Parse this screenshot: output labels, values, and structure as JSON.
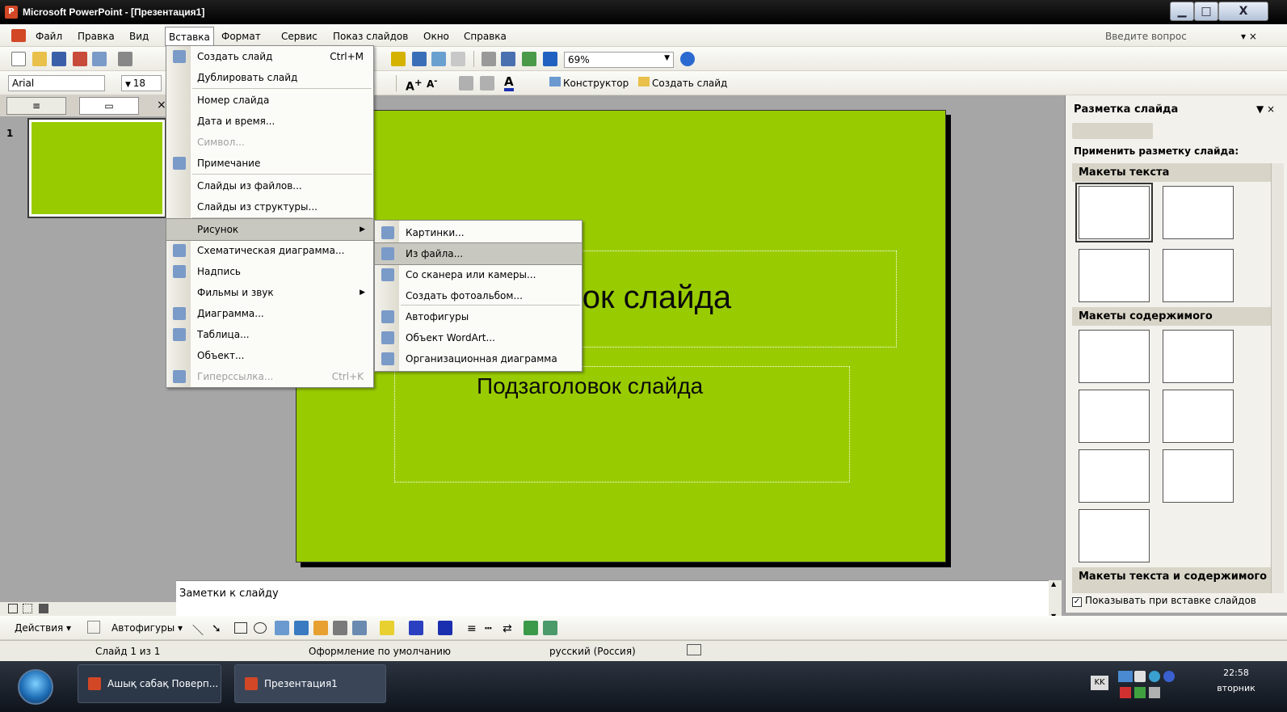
{
  "window": {
    "title": "Microsoft PowerPoint - [Презентация1]",
    "controls": {
      "min": "▁",
      "max": "□",
      "close": "X"
    }
  },
  "menubar": {
    "items": [
      "Файл",
      "Правка",
      "Вид",
      "Вставка",
      "Формат",
      "Сервис",
      "Показ слайдов",
      "Окно",
      "Справка"
    ],
    "help_placeholder": "Введите вопрос",
    "close_glyph": "▾ ×"
  },
  "toolbar": {
    "zoom": "69%",
    "font_name": "Arial",
    "font_size": "18",
    "designer_label": "Конструктор",
    "new_slide_label": "Создать слайд"
  },
  "left_pane": {
    "tab_outline_icon": "≡",
    "tab_slides_icon": "▭",
    "tab_close": "×",
    "slide_number": "1"
  },
  "slide": {
    "title_visible_text": "вок слайда",
    "subtitle_text": "Подзаголовок слайда",
    "bg_color": "#99cc00"
  },
  "notes": {
    "placeholder": "Заметки к слайду"
  },
  "insert_menu": {
    "items": [
      {
        "label": "Создать слайд",
        "shortcut": "Ctrl+M",
        "icon": "new-slide-icon"
      },
      {
        "label": "Дублировать слайд"
      },
      {
        "label": "Номер слайда"
      },
      {
        "label": "Дата и время..."
      },
      {
        "label": "Символ...",
        "disabled": true
      },
      {
        "label": "Примечание",
        "icon": "comment-icon"
      },
      {
        "label": "Слайды из файлов..."
      },
      {
        "label": "Слайды из структуры..."
      },
      {
        "label": "Рисунок",
        "submenu": true
      },
      {
        "label": "Схематическая диаграмма...",
        "icon": "diagram-icon"
      },
      {
        "label": "Надпись",
        "icon": "textbox-icon"
      },
      {
        "label": "Фильмы и звук",
        "submenu": true
      },
      {
        "label": "Диаграмма...",
        "icon": "chart-icon"
      },
      {
        "label": "Таблица...",
        "icon": "table-icon"
      },
      {
        "label": "Объект..."
      },
      {
        "label": "Гиперссылка...",
        "shortcut": "Ctrl+K",
        "disabled": true,
        "icon": "hyperlink-icon"
      }
    ]
  },
  "picture_submenu": {
    "items": [
      {
        "label": "Картинки...",
        "icon": "clipart-icon"
      },
      {
        "label": "Из файла...",
        "icon": "from-file-icon"
      },
      {
        "label": "Со сканера или камеры...",
        "icon": "scanner-icon"
      },
      {
        "label": "Создать фотоальбом..."
      },
      {
        "label": "Автофигуры",
        "icon": "autoshapes-icon"
      },
      {
        "label": "Объект WordArt...",
        "icon": "wordart-icon"
      },
      {
        "label": "Организационная диаграмма",
        "icon": "org-chart-icon"
      }
    ]
  },
  "task_pane": {
    "title": "Разметка слайда",
    "apply_label": "Применить разметку слайда:",
    "section_text": "Макеты текста",
    "section_content": "Макеты содержимого",
    "section_text_content": "Макеты текста и содержимого",
    "show_on_insert": "Показывать при вставке слайдов"
  },
  "drawing_toolbar": {
    "actions_label": "Действия ▾",
    "autoshapes_label": "Автофигуры ▾"
  },
  "statusbar": {
    "slide_info": "Слайд 1 из 1",
    "design": "Оформление по умолчанию",
    "language": "русский (Россия)"
  },
  "taskbar": {
    "tasks": [
      "Ашық сабақ Поверп...",
      "Презентация1"
    ],
    "lang": "KK",
    "time": "22:58",
    "day": "вторник"
  }
}
